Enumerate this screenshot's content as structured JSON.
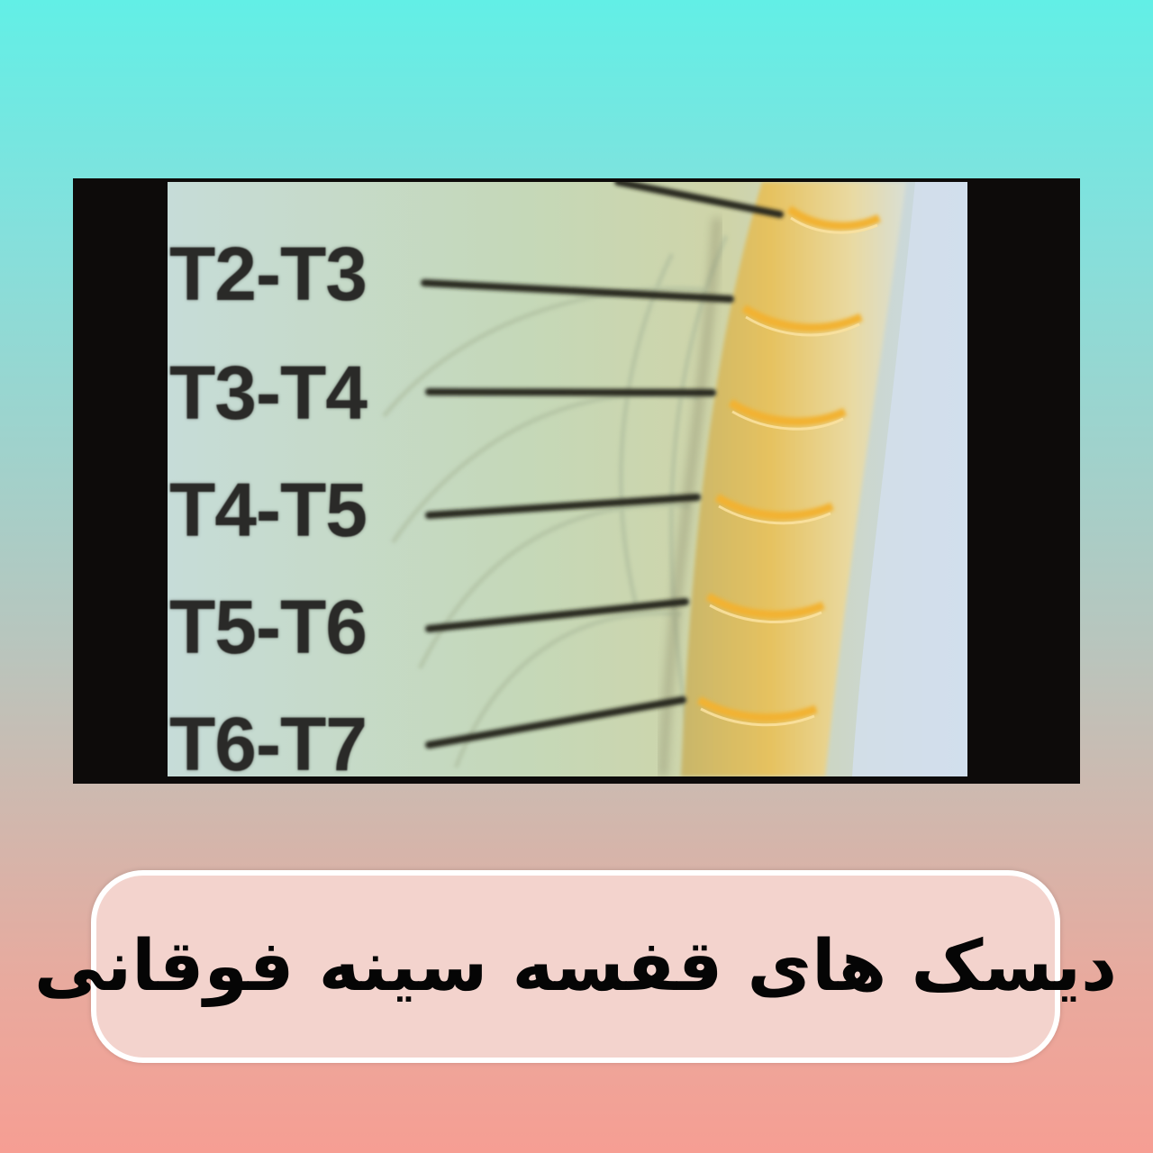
{
  "illustration": {
    "disc_labels": [
      "T2-T3",
      "T3-T4",
      "T4-T5",
      "T5-T6",
      "T6-T7"
    ]
  },
  "caption": {
    "text": "دیسک های قفسه سینه فوقانی"
  },
  "colors": {
    "background_top": "#62efe6",
    "background_bottom": "#f69e93",
    "caption_fill": "#f3d3cd",
    "caption_border": "#ffffff",
    "frame": "#0d0b0a",
    "disc_highlight": "#f2b233"
  }
}
